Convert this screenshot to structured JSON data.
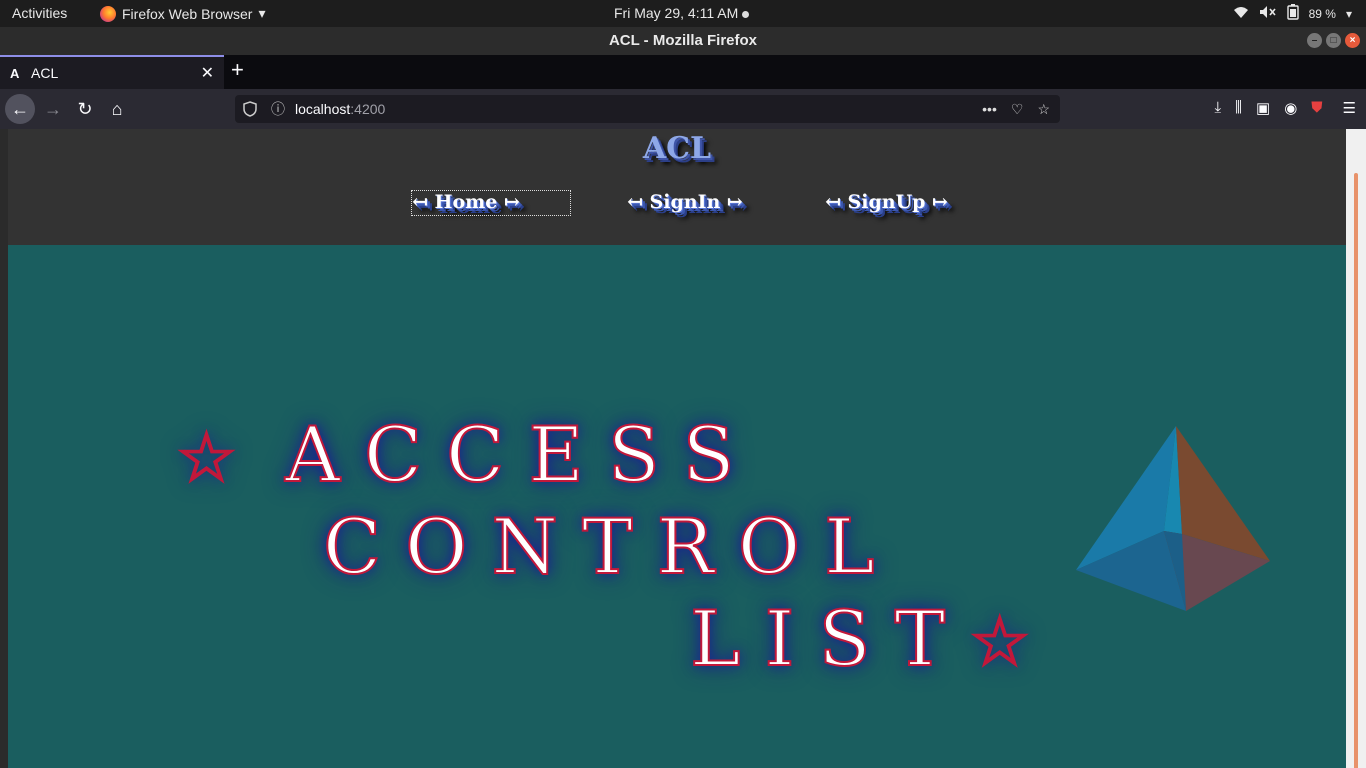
{
  "system": {
    "activities": "Activities",
    "app_name": "Firefox Web Browser",
    "clock": "Fri May 29,  4:11 AM",
    "battery": "89 %"
  },
  "window": {
    "title": "ACL - Mozilla Firefox"
  },
  "browser": {
    "tab_title": "ACL",
    "tab_favicon": "A",
    "url_host": "localhost",
    "url_port": ":4200"
  },
  "site": {
    "logo": "ACL",
    "nav": {
      "home": "↤ Home ↦",
      "signin": "↤ SignIn ↦",
      "signup": "↤ SignUp ↦"
    },
    "hero": {
      "line1_star": "☆",
      "line1": "ACCESS",
      "line2": "CONTROL",
      "line3": "LIST",
      "line3_star": "☆"
    }
  },
  "colors": {
    "header_bg": "#333333",
    "hero_bg": "#1a5e5f",
    "pyramid_left": "#1a7aa8",
    "pyramid_right": "#7a4a30"
  }
}
